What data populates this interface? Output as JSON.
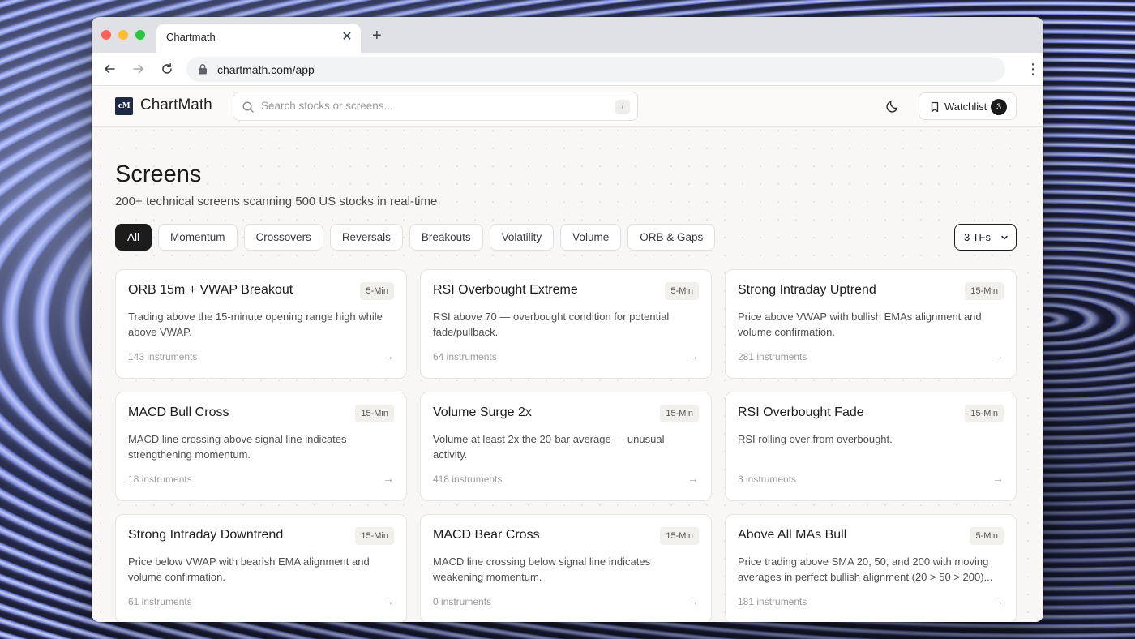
{
  "browser": {
    "tab_title": "Chartmath",
    "tab_close": "✕",
    "new_tab": "+",
    "url": "chartmath.com/app",
    "kebab": "⋮"
  },
  "header": {
    "logo_mark": "cM",
    "logo_text": "ChartMath",
    "search_placeholder": "Search stocks or screens...",
    "search_shortcut": "/",
    "watchlist_label": "Watchlist",
    "watchlist_count": "3"
  },
  "page": {
    "title": "Screens",
    "subtitle": "200+ technical screens scanning 500 US stocks in real-time"
  },
  "filters": [
    "All",
    "Momentum",
    "Crossovers",
    "Reversals",
    "Breakouts",
    "Volatility",
    "Volume",
    "ORB & Gaps"
  ],
  "active_filter": "All",
  "timeframe_select": "3 TFs",
  "cards": [
    {
      "title": "ORB 15m + VWAP Breakout",
      "tf": "5-Min",
      "desc": "Trading above the 15-minute opening range high while above VWAP.",
      "count": "143 instruments"
    },
    {
      "title": "RSI Overbought Extreme",
      "tf": "5-Min",
      "desc": "RSI above 70 — overbought condition for potential fade/pullback.",
      "count": "64 instruments"
    },
    {
      "title": "Strong Intraday Uptrend",
      "tf": "15-Min",
      "desc": "Price above VWAP with bullish EMAs alignment and volume confirmation.",
      "count": "281 instruments"
    },
    {
      "title": "MACD Bull Cross",
      "tf": "15-Min",
      "desc": "MACD line crossing above signal line indicates strengthening momentum.",
      "count": "18 instruments"
    },
    {
      "title": "Volume Surge 2x",
      "tf": "15-Min",
      "desc": "Volume at least 2x the 20-bar average — unusual activity.",
      "count": "418 instruments"
    },
    {
      "title": "RSI Overbought Fade",
      "tf": "15-Min",
      "desc": "RSI rolling over from overbought.",
      "count": "3 instruments"
    },
    {
      "title": "Strong Intraday Downtrend",
      "tf": "15-Min",
      "desc": "Price below VWAP with bearish EMA alignment and volume confirmation.",
      "count": "61 instruments"
    },
    {
      "title": "MACD Bear Cross",
      "tf": "15-Min",
      "desc": "MACD line crossing below signal line indicates weakening momentum.",
      "count": "0 instruments"
    },
    {
      "title": "Above All MAs Bull",
      "tf": "5-Min",
      "desc": "Price trading above SMA 20, 50, and 200 with moving averages in perfect bullish alignment (20 > 50 > 200)...",
      "count": "181 instruments"
    }
  ],
  "card_arrow": "→"
}
